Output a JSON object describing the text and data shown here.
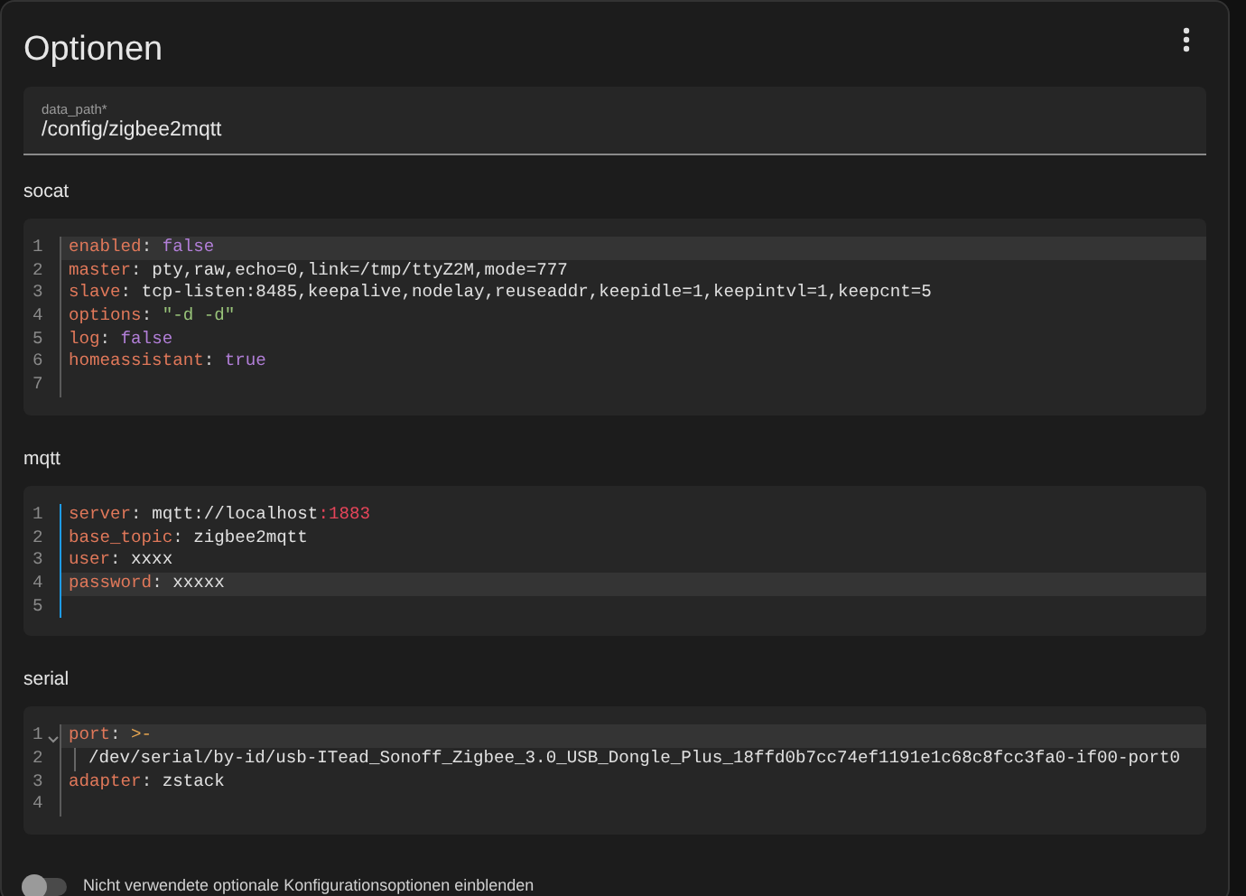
{
  "title": "Optionen",
  "field": {
    "label": "data_path*",
    "value": "/config/zigbee2mqtt"
  },
  "sections": [
    {
      "label": "socat",
      "focused": false,
      "lines": [
        {
          "number": "1",
          "current": true,
          "foldable": false,
          "tokens": [
            {
              "kind": "key",
              "text": "enabled"
            },
            {
              "kind": "punct",
              "text": ": "
            },
            {
              "kind": "bool",
              "text": "false"
            }
          ]
        },
        {
          "number": "2",
          "current": false,
          "foldable": false,
          "tokens": [
            {
              "kind": "key",
              "text": "master"
            },
            {
              "kind": "punct",
              "text": ": "
            },
            {
              "kind": "plain",
              "text": "pty,raw,echo=0,link=/tmp/ttyZ2M,mode=777"
            }
          ]
        },
        {
          "number": "3",
          "current": false,
          "foldable": false,
          "tokens": [
            {
              "kind": "key",
              "text": "slave"
            },
            {
              "kind": "punct",
              "text": ": "
            },
            {
              "kind": "plain",
              "text": "tcp-listen:8485,keepalive,nodelay,reuseaddr,keepidle=1,keepintvl=1,keepcnt=5"
            }
          ]
        },
        {
          "number": "4",
          "current": false,
          "foldable": false,
          "tokens": [
            {
              "kind": "key",
              "text": "options"
            },
            {
              "kind": "punct",
              "text": ": "
            },
            {
              "kind": "string",
              "text": "\"-d -d\""
            }
          ]
        },
        {
          "number": "5",
          "current": false,
          "foldable": false,
          "tokens": [
            {
              "kind": "key",
              "text": "log"
            },
            {
              "kind": "punct",
              "text": ": "
            },
            {
              "kind": "bool",
              "text": "false"
            }
          ]
        },
        {
          "number": "6",
          "current": false,
          "foldable": false,
          "tokens": [
            {
              "kind": "key",
              "text": "homeassistant"
            },
            {
              "kind": "punct",
              "text": ": "
            },
            {
              "kind": "bool",
              "text": "true"
            }
          ]
        },
        {
          "number": "7",
          "current": false,
          "foldable": false
        }
      ]
    },
    {
      "label": "mqtt",
      "focused": true,
      "lines": [
        {
          "number": "1",
          "current": false,
          "foldable": false,
          "tokens": [
            {
              "kind": "key",
              "text": "server"
            },
            {
              "kind": "punct",
              "text": ": "
            },
            {
              "kind": "plain",
              "text": "mqtt://localhost"
            },
            {
              "kind": "number",
              "text": ":1883"
            }
          ]
        },
        {
          "number": "2",
          "current": false,
          "foldable": false,
          "tokens": [
            {
              "kind": "key",
              "text": "base_topic"
            },
            {
              "kind": "punct",
              "text": ": "
            },
            {
              "kind": "plain",
              "text": "zigbee2mqtt"
            }
          ]
        },
        {
          "number": "3",
          "current": false,
          "foldable": false,
          "tokens": [
            {
              "kind": "key",
              "text": "user"
            },
            {
              "kind": "punct",
              "text": ": "
            },
            {
              "kind": "plain",
              "text": "xxxx"
            }
          ]
        },
        {
          "number": "4",
          "current": true,
          "foldable": false,
          "tokens": [
            {
              "kind": "key",
              "text": "password"
            },
            {
              "kind": "punct",
              "text": ": "
            },
            {
              "kind": "plain",
              "text": "xxxxx"
            }
          ]
        },
        {
          "number": "5",
          "current": false,
          "foldable": false
        }
      ]
    },
    {
      "label": "serial",
      "focused": false,
      "lines": [
        {
          "number": "1",
          "current": true,
          "foldable": true,
          "tokens": [
            {
              "kind": "key",
              "text": "port"
            },
            {
              "kind": "punct",
              "text": ": "
            },
            {
              "kind": "symbol",
              "text": ">-"
            }
          ]
        },
        {
          "number": "2",
          "current": false,
          "foldable": false,
          "indented": true,
          "tokens": [
            {
              "kind": "plain",
              "text": "/dev/serial/by-id/usb-ITead_Sonoff_Zigbee_3.0_USB_Dongle_Plus_18ffd0b7cc74ef1191e1c68c8fcc3fa0-if00-port0"
            }
          ]
        },
        {
          "number": "3",
          "current": false,
          "foldable": false,
          "tokens": [
            {
              "kind": "key",
              "text": "adapter"
            },
            {
              "kind": "punct",
              "text": ": "
            },
            {
              "kind": "plain",
              "text": "zstack"
            }
          ]
        },
        {
          "number": "4",
          "current": false,
          "foldable": false
        }
      ]
    }
  ],
  "toggle": {
    "label": "Nicht verwendete optionale Konfigurationsoptionen einblenden",
    "on": false
  }
}
